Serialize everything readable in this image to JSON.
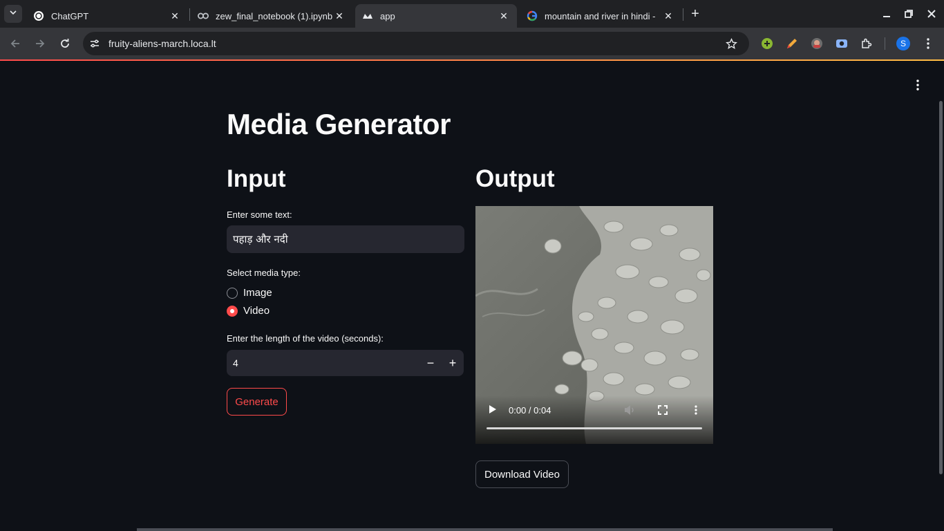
{
  "browser": {
    "tabs": [
      {
        "title": "ChatGPT",
        "icon": "chatgpt-icon"
      },
      {
        "title": "zew_final_notebook (1).ipynb",
        "icon": "colab-icon"
      },
      {
        "title": "app",
        "icon": "streamlit-icon",
        "active": true
      },
      {
        "title": "mountain and river in hindi -",
        "icon": "google-icon"
      }
    ],
    "url": "fruity-aliens-march.loca.lt",
    "profile_initial": "S"
  },
  "page": {
    "title": "Media Generator",
    "input": {
      "heading": "Input",
      "text_label": "Enter some text:",
      "text_value": "पहाड़ और नदी",
      "media_type_label": "Select media type:",
      "media_options": [
        "Image",
        "Video"
      ],
      "media_selected": "Video",
      "length_label": "Enter the length of the video (seconds):",
      "length_value": "4",
      "minus": "−",
      "plus": "+",
      "generate_label": "Generate"
    },
    "output": {
      "heading": "Output",
      "video_time": "0:00 / 0:04",
      "download_label": "Download Video"
    }
  },
  "colors": {
    "background": "#0e1117",
    "accent": "#ff4b4b",
    "input_bg": "#262730",
    "text": "#fafafa"
  }
}
